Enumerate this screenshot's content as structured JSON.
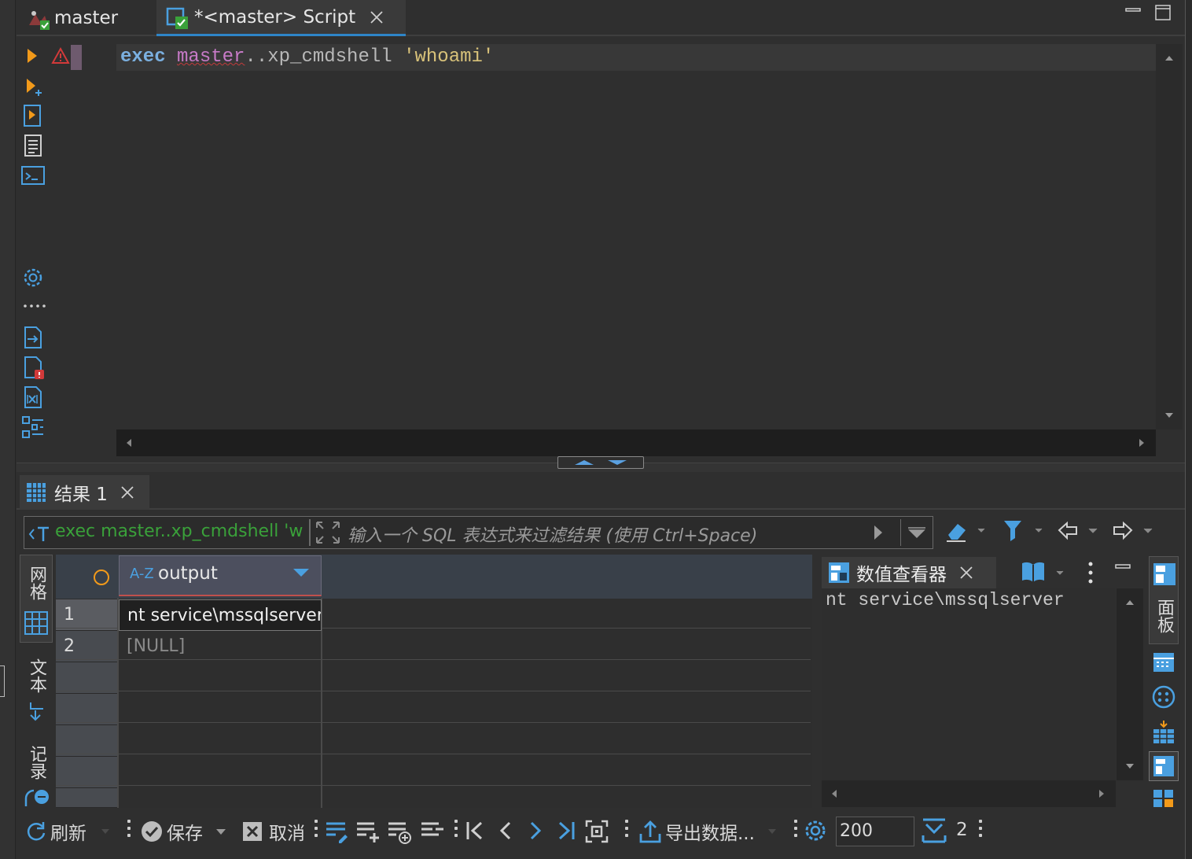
{
  "tabs": [
    {
      "label": "master",
      "active": false
    },
    {
      "label": "*<master> Script",
      "active": true
    }
  ],
  "editor": {
    "code": {
      "keyword": "exec",
      "object": "master",
      "rest": "..xp_cmdshell",
      "string": "'whoami'"
    }
  },
  "results": {
    "tab_label": "结果 1",
    "filter_query": "exec master..xp_cmdshell 'whoami'",
    "filter_placeholder": "输入一个 SQL 表达式来过滤结果 (使用 Ctrl+Space)",
    "side_tabs": {
      "grid": "网格",
      "text": "文本",
      "record": "记录"
    },
    "columns": [
      {
        "type_badge": "A-Z",
        "name": "output"
      }
    ],
    "rows": [
      {
        "num": "1",
        "output": "nt service\\mssqlserver"
      },
      {
        "num": "2",
        "output": "[NULL]"
      }
    ]
  },
  "value_viewer": {
    "title": "数值查看器",
    "content": "nt service\\mssqlserver",
    "right_panel_label": "面板"
  },
  "toolbar": {
    "refresh": "刷新",
    "save": "保存",
    "cancel": "取消",
    "export": "导出数据...",
    "fetch_size": "200",
    "row_count": "2"
  },
  "colors": {
    "accent": "#2e85c8",
    "keyword": "#7bb0e0",
    "string": "#d8c27a",
    "filter_text": "#3aa13a",
    "null": "#8a8a8a"
  }
}
